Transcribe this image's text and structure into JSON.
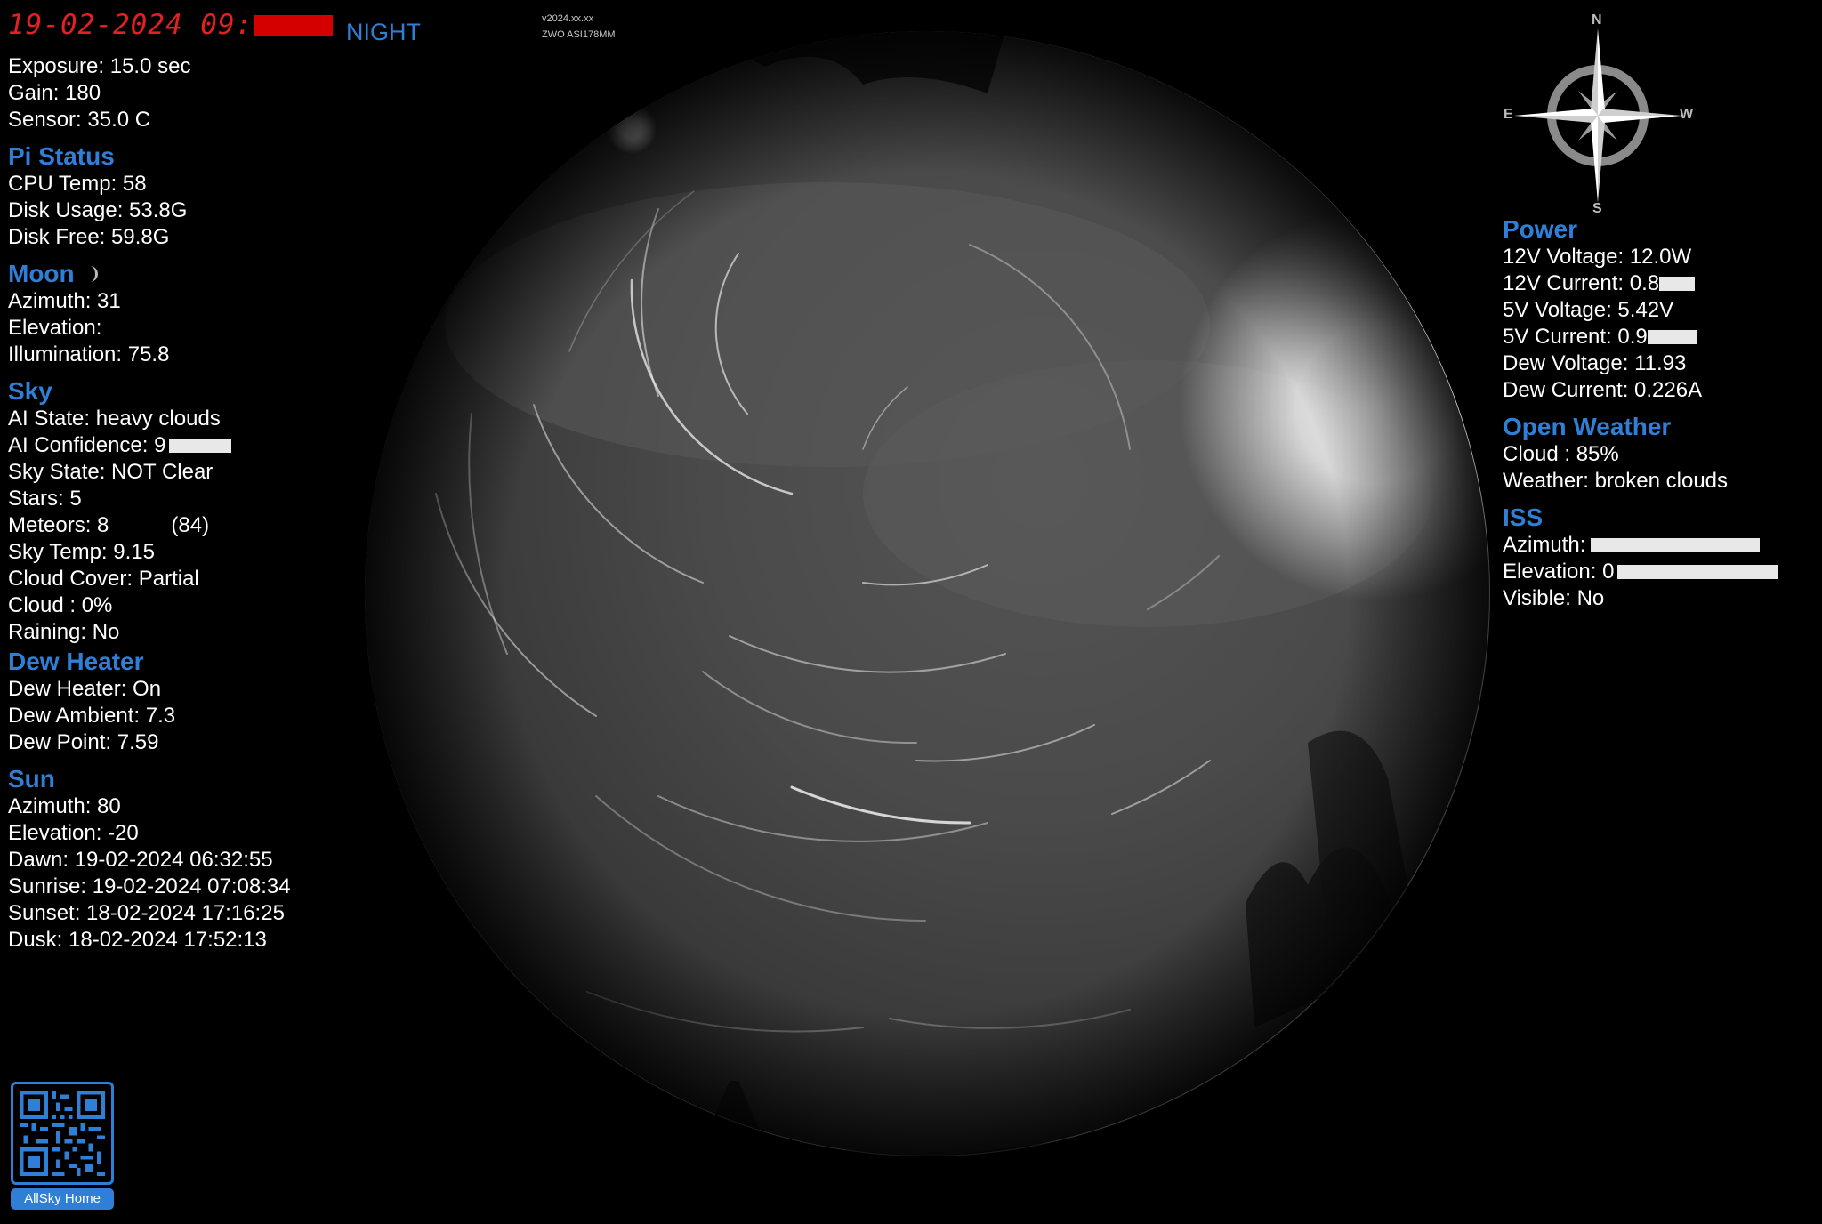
{
  "header": {
    "date_text": "19-02-2024 09:",
    "mode": "NIGHT",
    "version": "v2024.xx.xx",
    "camera": "ZWO ASI178MM"
  },
  "camera": {
    "exposure": "Exposure: 15.0 sec",
    "gain": "Gain: 180",
    "sensor": "Sensor: 35.0 C"
  },
  "pi_status": {
    "title": "Pi Status",
    "cpu_temp": "CPU Temp: 58",
    "disk_usage": "Disk Usage: 53.8G",
    "disk_free": "Disk Free: 59.8G"
  },
  "moon": {
    "title": "Moon",
    "azimuth": "Azimuth: 31",
    "elevation": "Elevation:",
    "illumination": "Illumination: 75.8"
  },
  "sky": {
    "title": "Sky",
    "ai_state": "AI State: heavy clouds",
    "ai_confidence": "AI Confidence: 9",
    "sky_state": "Sky State: NOT Clear",
    "stars": "Stars: 5",
    "meteors": "Meteors: 8",
    "meteors_extra": "(84)",
    "sky_temp": "Sky Temp: 9.15",
    "cloud_cover": "Cloud Cover: Partial",
    "cloud": "Cloud : 0%",
    "raining": "Raining: No"
  },
  "dew_heater": {
    "title": "Dew Heater",
    "heater": "Dew Heater: On",
    "ambient": "Dew Ambient: 7.3",
    "dew_point": "Dew Point: 7.59"
  },
  "sun": {
    "title": "Sun",
    "azimuth": "Azimuth: 80",
    "elevation": "Elevation: -20",
    "dawn": "Dawn: 19-02-2024 06:32:55",
    "sunrise": "Sunrise: 19-02-2024 07:08:34",
    "sunset": "Sunset: 18-02-2024 17:16:25",
    "dusk": "Dusk: 18-02-2024 17:52:13"
  },
  "power": {
    "title": "Power",
    "v12": "12V Voltage: 12.0W",
    "i12": "12V Current: 0.8",
    "v5": "5V Voltage: 5.42V",
    "i5": "5V Current: 0.9",
    "dew_voltage": "Dew Voltage: 11.93",
    "dew_current": "Dew Current: 0.226A"
  },
  "open_weather": {
    "title": "Open Weather",
    "cloud": "Cloud : 85%",
    "weather": "Weather: broken clouds"
  },
  "iss": {
    "title": "ISS",
    "azimuth": "Azimuth:",
    "elevation": "Elevation: 0",
    "visible": "Visible: No"
  },
  "compass": {
    "north": "N",
    "south": "S",
    "east": "E",
    "west": "W",
    "icon": "compass-rose-icon"
  },
  "qr": {
    "icon": "qr-code-icon",
    "caption": "AllSky Home"
  },
  "colors": {
    "accent": "#2f7fd6",
    "date_red": "#e52020",
    "text": "#ffffff",
    "background": "#000000"
  }
}
